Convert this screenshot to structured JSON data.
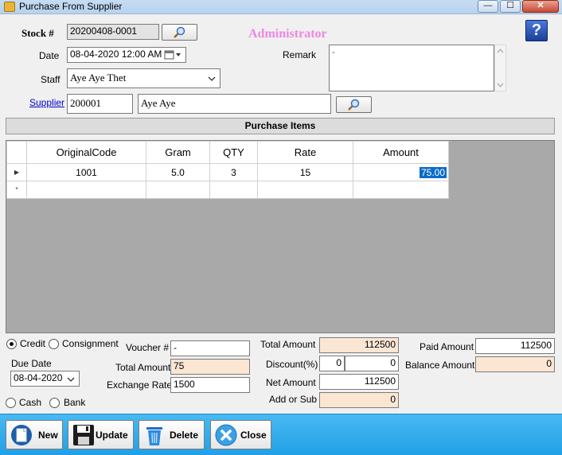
{
  "window": {
    "title": "Purchase From Supplier",
    "minimize": "—",
    "maximize": "☐",
    "close": "✕"
  },
  "header": {
    "stock_label": "Stock #",
    "stock_value": "20200408-0001",
    "admin": "Administrator",
    "date_label": "Date",
    "date_value": "08-04-2020 12:00 AM",
    "staff_label": "Staff",
    "staff_value": "Aye Aye Thet",
    "remark_label": "Remark",
    "remark_value": "-",
    "supplier_label": "Supplier",
    "supplier_code": "200001",
    "supplier_name": "Aye Aye",
    "help": "?"
  },
  "section_title": "Purchase Items",
  "grid": {
    "columns": [
      "OriginalCode",
      "Gram",
      "QTY",
      "Rate",
      "Amount"
    ],
    "rows": [
      {
        "marker": "▶",
        "cells": [
          "1001",
          "5.0",
          "3",
          "15",
          "75.00"
        ]
      },
      {
        "marker": "*",
        "cells": [
          "",
          "",
          "",
          "",
          ""
        ]
      }
    ]
  },
  "options": {
    "credit_label": "Credit",
    "consignment_label": "Consignment",
    "cash_label": "Cash",
    "bank_label": "Bank",
    "selected": "credit",
    "due_date_label": "Due Date",
    "due_date_value": "08-04-2020"
  },
  "middle": {
    "voucher_label": "Voucher #",
    "voucher_value": "-",
    "total_amount_label": "Total Amount",
    "total_amount_value": "75",
    "exchange_rate_label": "Exchange Rate",
    "exchange_rate_value": "1500"
  },
  "totals": {
    "total_amount_label": "Total Amount",
    "total_amount_value": "112500",
    "discount_label": "Discount(%)",
    "discount_pct": "0",
    "discount_amount": "0",
    "net_amount_label": "Net Amount",
    "net_amount_value": "112500",
    "add_sub_label": "Add or Sub",
    "add_sub_value": "0",
    "paid_amount_label": "Paid Amount",
    "paid_amount_value": "112500",
    "balance_amount_label": "Balance Amount",
    "balance_amount_value": "0"
  },
  "actions": {
    "new": "New",
    "update": "Update",
    "delete": "Delete",
    "close": "Close"
  },
  "colors": {
    "title_bar": "#c6dcf2",
    "bottom_bar": "#2fa9ec",
    "readonly_peach": "#fbe6d4",
    "admin": "#ec88e2",
    "selection": "#0a6cc8"
  }
}
